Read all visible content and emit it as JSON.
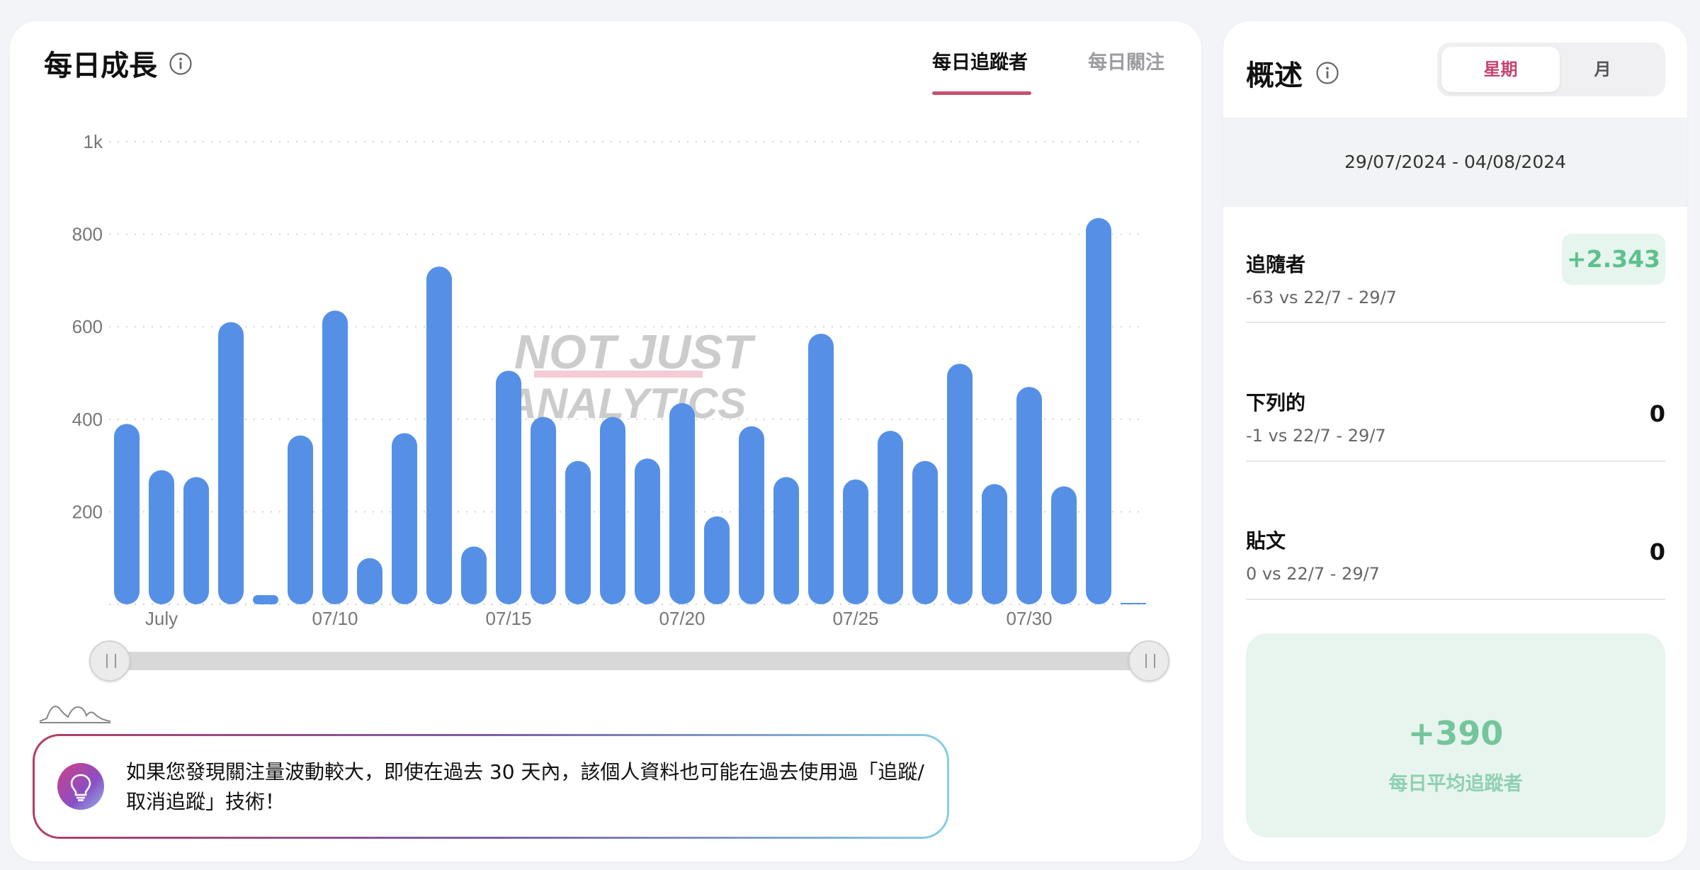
{
  "growth": {
    "title": "每日成長",
    "tabs": [
      {
        "label": "每日追蹤者",
        "active": true
      },
      {
        "label": "每日關注",
        "active": false
      }
    ],
    "watermark": [
      "NOT JUST",
      "ANALYTICS"
    ],
    "tip": "如果您發現關注量波動較大，即使在過去 30 天內，該個人資料也可能在過去使用過「追蹤/取消追蹤」技術！"
  },
  "chart_data": {
    "type": "bar",
    "y_ticks": [
      "200",
      "400",
      "600",
      "800",
      "1k"
    ],
    "ylim": [
      0,
      1000
    ],
    "x_tick_labels": [
      {
        "label": "July",
        "index": 1
      },
      {
        "label": "07/10",
        "index": 6
      },
      {
        "label": "07/15",
        "index": 11
      },
      {
        "label": "07/20",
        "index": 16
      },
      {
        "label": "07/25",
        "index": 21
      },
      {
        "label": "07/30",
        "index": 26
      }
    ],
    "values": [
      390,
      290,
      275,
      610,
      20,
      365,
      635,
      100,
      370,
      730,
      125,
      505,
      405,
      310,
      405,
      315,
      435,
      190,
      385,
      275,
      585,
      270,
      375,
      310,
      520,
      260,
      470,
      255,
      835,
      2
    ],
    "bar_color": "#5590e6",
    "grid": "dotted"
  },
  "overview": {
    "title": "概述",
    "period_toggle": {
      "week": "星期",
      "month": "月",
      "selected": "week"
    },
    "date_range": "29/07/2024 - 04/08/2024",
    "metrics": [
      {
        "label": "追隨者",
        "sub": "-63 vs 22/7 - 29/7",
        "value": "+2.343"
      },
      {
        "label": "下列的",
        "sub": "-1 vs 22/7 - 29/7",
        "value": "0"
      },
      {
        "label": "貼文",
        "sub": "0 vs 22/7 - 29/7",
        "value": "0"
      }
    ],
    "avg": {
      "value": "+390",
      "label": "每日平均追蹤者"
    }
  },
  "colors": {
    "accent": "#c8426d",
    "positive": "#5dc18d",
    "bar": "#5590e6"
  }
}
